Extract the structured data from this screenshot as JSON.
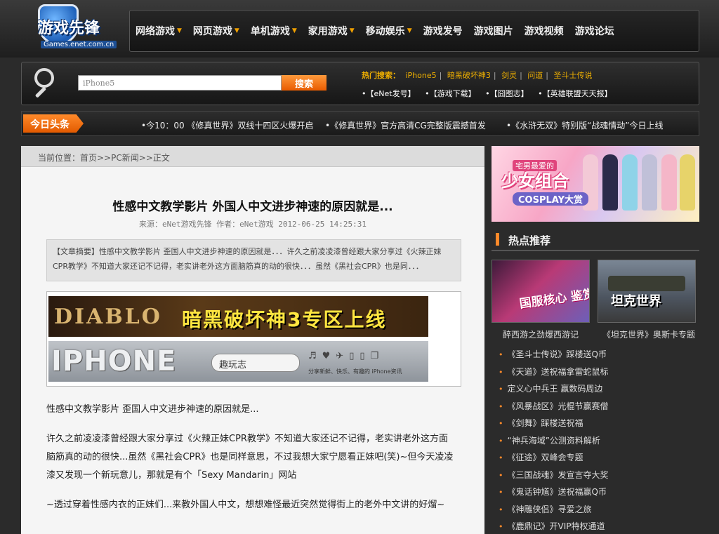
{
  "logo": {
    "title": "游戏先锋",
    "domain": "Games.enet.com.cn"
  },
  "nav": {
    "items": [
      {
        "label": "网络游戏",
        "arrow": "▼"
      },
      {
        "label": "网页游戏",
        "arrow": "▼"
      },
      {
        "label": "单机游戏",
        "arrow": "▼"
      },
      {
        "label": "家用游戏",
        "arrow": "▼"
      },
      {
        "label": "移动娱乐",
        "arrow": "▼"
      },
      {
        "label": "游戏发号",
        "arrow": ""
      },
      {
        "label": "游戏图片",
        "arrow": ""
      },
      {
        "label": "游戏视频",
        "arrow": ""
      },
      {
        "label": "游戏论坛",
        "arrow": ""
      }
    ]
  },
  "search": {
    "value": "iPhone5",
    "button_label": "搜索",
    "hot_label": "热门搜索：",
    "hot_keywords": [
      "iPhone5",
      "暗黑破坏神3",
      "剑灵",
      "问道",
      "圣斗士传说"
    ],
    "separator": "|",
    "quick_links": [
      "•【eNet发号】",
      "•【游戏下载】",
      "•【囧图志】",
      "•【英雄联盟天天报】"
    ]
  },
  "headline": {
    "badge": "今日头条",
    "items": [
      "•今10：00 《修真世界》双线十四区火爆开启",
      "•《修真世界》官方高清CG完整版震撼首发",
      "•《水浒无双》特别版“战魂情动”今日上线"
    ]
  },
  "breadcrumb": "当前位置：首页>>PC新闻>>正文",
  "article": {
    "title": "性感中文教学影片 外国人中文进步神速的原因就是...",
    "meta": "来源：eNet游戏先锋 作者：eNet游戏 2012-06-25 14:25:31",
    "summary": "【文章摘要】性感中文教学影片 歪国人中文进步神速的原因就是．．．许久之前凌凌漆曾经跟大家分享过《火辣正妹CPR教学》不知道大家还记不记得，老实讲老外这方面脑筋真的动的很快．．．虽然《黑社会CPR》也是同．．．",
    "banner1": {
      "logo": "DIABLO",
      "text": "暗黑破坏神3专区上线"
    },
    "banner2": {
      "big": "IPHONE",
      "fun": "趣玩志",
      "icons": "♬♥✈▯▯❐",
      "slogan": "分享新鲜、快乐、有趣的 iPhone资讯"
    },
    "p1": "性感中文教学影片 歪国人中文进步神速的原因就是...",
    "p2": "许久之前凌凌漆曾经跟大家分享过《火辣正妹CPR教学》不知道大家还记不记得，老实讲老外这方面脑筋真的动的很快...虽然《黑社会CPR》也是同样意思，不过我想大家宁愿看正妹吧(笑)~但今天凌凌漆又发现一个新玩意儿，那就是有个「Sexy Mandarin」网站",
    "p3": "~透过穿着性感内衣的正妹们...来教外国人中文，想想难怪最近突然觉得街上的老外中文讲的好熘~"
  },
  "sidebar": {
    "ad": {
      "main": "少女组合",
      "top": "宅男最爱的",
      "bottom": "COSPLAY大赏"
    },
    "hot_title": "热点推荐",
    "thumb1": {
      "overlay": "国服核心 鉴赏测试",
      "caption": "醉西游之劲爆西游记"
    },
    "thumb2": {
      "overlay": "坦克世界",
      "caption": "《坦克世界》奥斯卡专题"
    },
    "list": [
      "《圣斗士传说》踩楼送Q币",
      "《天道》送祝福拿雷蛇鼠标",
      "定义心中兵王 赢数码周边",
      "《风暴战区》光棍节赢赛僧",
      "《剑舞》踩楼送祝福",
      "“神兵海域”公测资料解析",
      "《征途》双峰会专题",
      "《三国战魂》发宣言夺大奖",
      "《鬼话钟馗》送祝福赢Q币",
      "《神雕侠侣》寻爱之旅",
      "《鹿鼎记》开VIP特权通道"
    ]
  },
  "colors": {
    "accent": "#ff8a2a",
    "hot_keyword": "#f0b000",
    "background": "#2b2b2b"
  }
}
